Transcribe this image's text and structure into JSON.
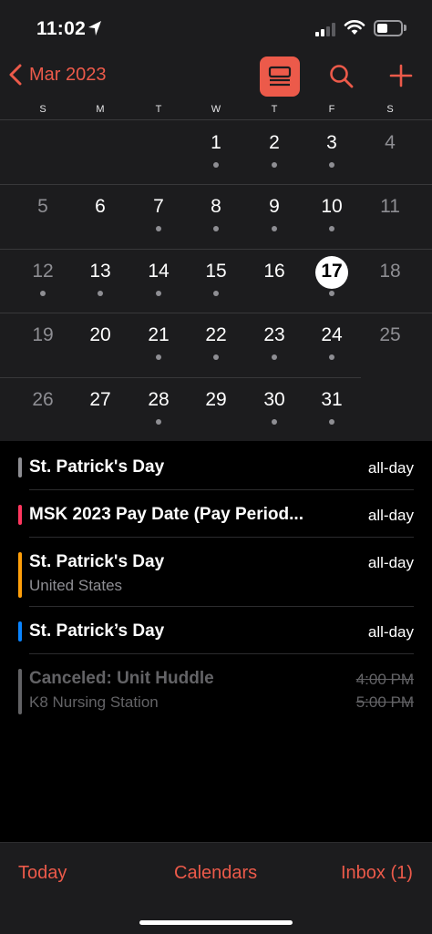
{
  "status": {
    "time": "11:02"
  },
  "nav": {
    "month_label": "Mar 2023"
  },
  "weekdays": [
    "S",
    "M",
    "T",
    "W",
    "T",
    "F",
    "S"
  ],
  "calendar": {
    "today": "17",
    "days": [
      {
        "n": "1",
        "dot": true
      },
      {
        "n": "2",
        "dot": true
      },
      {
        "n": "3",
        "dot": true
      },
      {
        "n": "4",
        "dot": false
      },
      {
        "n": "5",
        "dot": false
      },
      {
        "n": "6",
        "dot": false
      },
      {
        "n": "7",
        "dot": true
      },
      {
        "n": "8",
        "dot": true
      },
      {
        "n": "9",
        "dot": true
      },
      {
        "n": "10",
        "dot": true
      },
      {
        "n": "11",
        "dot": false
      },
      {
        "n": "12",
        "dot": true
      },
      {
        "n": "13",
        "dot": true
      },
      {
        "n": "14",
        "dot": true
      },
      {
        "n": "15",
        "dot": true
      },
      {
        "n": "16",
        "dot": false
      },
      {
        "n": "17",
        "dot": true
      },
      {
        "n": "18",
        "dot": false
      },
      {
        "n": "19",
        "dot": false
      },
      {
        "n": "20",
        "dot": false
      },
      {
        "n": "21",
        "dot": true
      },
      {
        "n": "22",
        "dot": true
      },
      {
        "n": "23",
        "dot": true
      },
      {
        "n": "24",
        "dot": true
      },
      {
        "n": "25",
        "dot": false
      },
      {
        "n": "26",
        "dot": false
      },
      {
        "n": "27",
        "dot": false
      },
      {
        "n": "28",
        "dot": true
      },
      {
        "n": "29",
        "dot": false
      },
      {
        "n": "30",
        "dot": true
      },
      {
        "n": "31",
        "dot": true
      }
    ]
  },
  "events": [
    {
      "title": "St. Patrick's Day",
      "subtitle": "",
      "time": "all-day",
      "time2": "",
      "color": "#8e8e93",
      "canceled": false
    },
    {
      "title": "MSK 2023 Pay Date (Pay Period...",
      "subtitle": "",
      "time": "all-day",
      "time2": "",
      "color": "#ff375f",
      "canceled": false
    },
    {
      "title": "St. Patrick's Day",
      "subtitle": "United States",
      "time": "all-day",
      "time2": "",
      "color": "#ff9f0a",
      "canceled": false
    },
    {
      "title": "St. Patrick’s Day",
      "subtitle": "",
      "time": "all-day",
      "time2": "",
      "color": "#0a84ff",
      "canceled": false
    },
    {
      "title": "Canceled: Unit Huddle",
      "subtitle": "K8 Nursing Station",
      "time": "4:00 PM",
      "time2": "5:00 PM",
      "color": "#636366",
      "canceled": true
    }
  ],
  "toolbar": {
    "today": "Today",
    "calendars": "Calendars",
    "inbox": "Inbox (1)"
  },
  "colors": {
    "accent": "#ec5a4a"
  }
}
